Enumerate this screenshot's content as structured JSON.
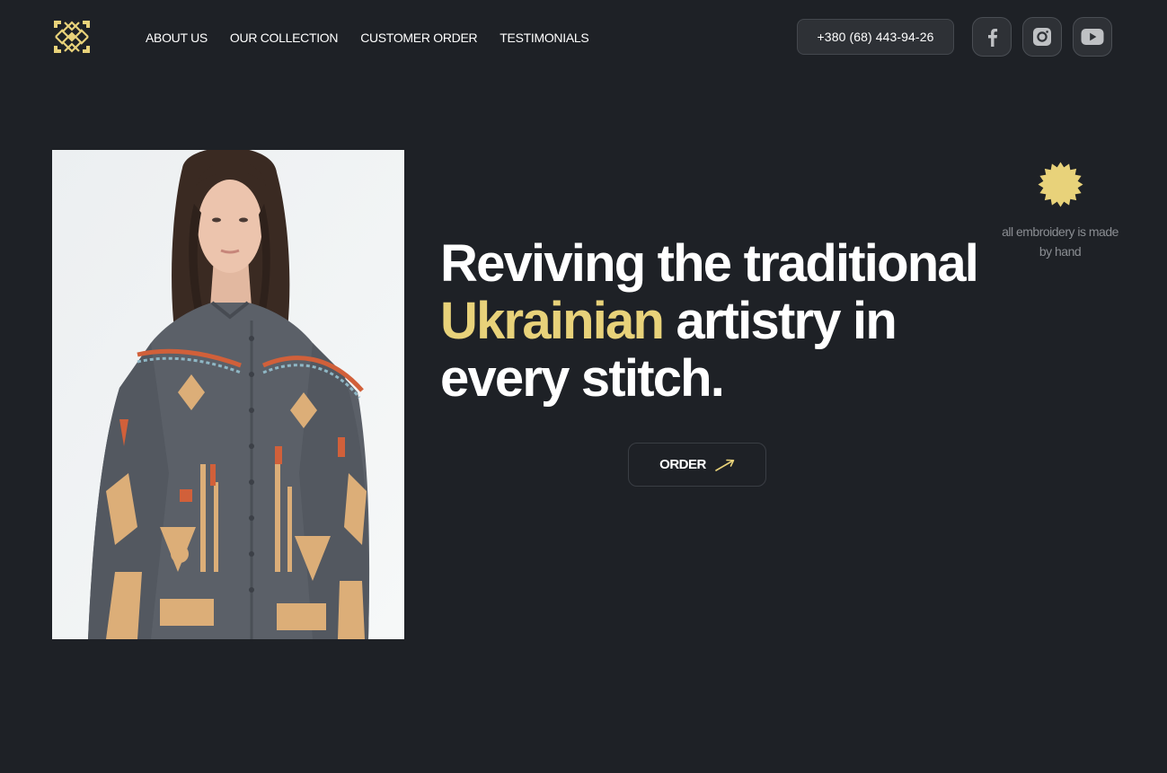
{
  "header": {
    "logo_icon": "embroidery-ornament-logo",
    "nav": [
      {
        "label": "ABOUT US"
      },
      {
        "label": "OUR COLLECTION"
      },
      {
        "label": "CUSTOMER ORDER"
      },
      {
        "label": "TESTIMONIALS"
      }
    ],
    "phone": "+380 (68) 443-94-26",
    "social": [
      {
        "icon": "facebook-icon"
      },
      {
        "icon": "instagram-icon"
      },
      {
        "icon": "youtube-icon"
      }
    ]
  },
  "hero": {
    "image_icon": "model-in-embroidered-shirt-photo",
    "headline_part1": "Reviving the traditional ",
    "headline_accent": "Ukrainian",
    "headline_part2": " artistry in every stitch.",
    "order_label": "ORDER",
    "order_icon": "arrow-up-right-icon",
    "badge_icon": "starburst-icon",
    "badge_text": "all embroidery is made by hand"
  },
  "colors": {
    "background": "#1e2126",
    "accent": "#e8d27a",
    "button_bg": "#2e3136",
    "muted_text": "#8a8d92"
  }
}
